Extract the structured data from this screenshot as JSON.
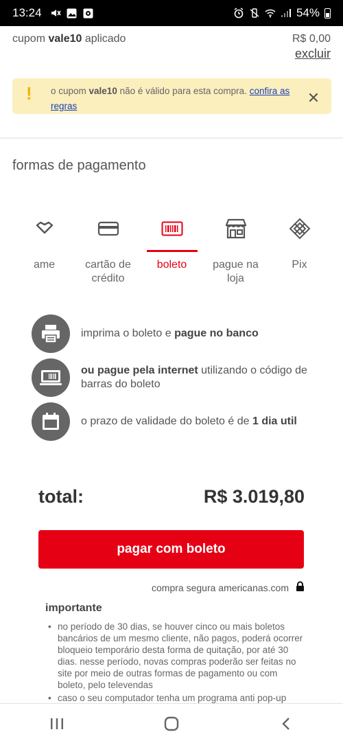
{
  "status": {
    "time": "13:24",
    "battery": "54%"
  },
  "coupon": {
    "prefix": "cupom ",
    "code": "vale10",
    "suffix": " aplicado",
    "amount": "R$ 0,00",
    "remove_label": "excluir"
  },
  "alert": {
    "text_1": "o cupom ",
    "code": "vale10",
    "text_2": " não é válido para esta compra. ",
    "link": "confira as regras"
  },
  "payment": {
    "title": "formas de pagamento",
    "tabs": [
      {
        "label": "ame",
        "icon": "heart-icon",
        "active": false
      },
      {
        "label": "cartão de crédito",
        "icon": "credit-card-icon",
        "active": false
      },
      {
        "label": "boleto",
        "icon": "barcode-icon",
        "active": true
      },
      {
        "label": "pague na loja",
        "icon": "store-icon",
        "active": false
      },
      {
        "label": "Pix",
        "icon": "pix-icon",
        "active": false
      }
    ]
  },
  "info": [
    {
      "icon": "printer-icon",
      "text_1": "imprima o boleto e ",
      "bold": "pague no banco",
      "text_2": ""
    },
    {
      "icon": "computer-barcode-icon",
      "text_1": "",
      "bold": "ou pague pela internet",
      "text_2": " utilizando o código de barras do boleto"
    },
    {
      "icon": "calendar-icon",
      "text_1": "o prazo de validade do boleto é de ",
      "bold": "1 dia util",
      "text_2": ""
    }
  ],
  "total": {
    "label": "total:",
    "value": "R$ 3.019,80"
  },
  "pay_button": "pagar com boleto",
  "secure_text": "compra segura americanas.com",
  "important": {
    "title": "importante",
    "items": [
      "no período de 30 dias, se houver cinco ou mais boletos bancários de um mesmo cliente, não pagos, poderá ocorrer bloqueio temporário desta forma de quitação, por até 30 dias. nesse período, novas compras poderão ser feitas no site por meio de outras formas de pagamento ou com boleto, pelo televendas",
      "caso o seu computador tenha um programa anti pop-up"
    ]
  },
  "colors": {
    "accent": "#e60014",
    "alert_bg": "#fbefbe",
    "alert_icon": "#f0b400",
    "link": "#1a3fb5"
  }
}
